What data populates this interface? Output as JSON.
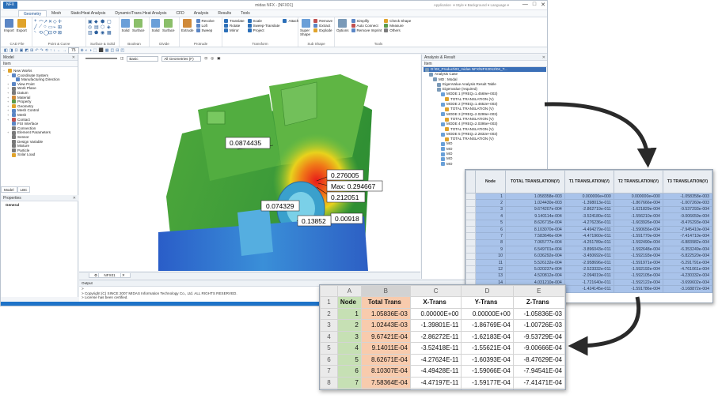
{
  "window": {
    "title": "midas NFX - [NFX01]",
    "logo": "NFX",
    "right_items": [
      "Application",
      "Style",
      "Background",
      "Language"
    ],
    "controls": [
      "—",
      "□",
      "✕"
    ]
  },
  "menu": {
    "tabs": [
      "Geometry",
      "Mesh",
      "Static/Heat Analysis",
      "Dynamic/Trans.Heat Analysis",
      "CFD",
      "Analysis",
      "Results",
      "Tools"
    ],
    "active": "Geometry"
  },
  "ribbon": {
    "cad_file": {
      "label": "CAD File",
      "buttons": [
        "Import",
        "Export"
      ]
    },
    "point_curve": {
      "label": "Point & Curve"
    },
    "surface_solid": {
      "label": "Surface & Solid"
    },
    "boolean": {
      "label": "Boolean",
      "buttons": [
        "Solid",
        "Surface"
      ]
    },
    "divide": {
      "label": "Divide",
      "buttons": [
        "Solid",
        "Surface"
      ]
    },
    "protrude": {
      "label": "Protrude",
      "buttons": [
        "Extrude",
        "Revolve",
        "Loft",
        "Sweep"
      ]
    },
    "transform": {
      "label": "Transform",
      "items": [
        "Translate",
        "Rotate",
        "Mirror",
        "Scale",
        "Sweep-Translate",
        "Project",
        "Attach"
      ]
    },
    "sub_shape": {
      "label": "Sub Shape",
      "buttons": [
        "Super Shape",
        "Remove",
        "Extract",
        "Explode"
      ]
    },
    "tools": {
      "label": "Tools",
      "buttons": [
        "Options",
        "Simplify",
        "Auto Connect",
        "Remove Imprint",
        "Check Shape",
        "Measure",
        "Others"
      ]
    }
  },
  "viewport_toolbar": {
    "style_select": "Basic",
    "filter_select": "All Geometries (F)",
    "zoom": "75"
  },
  "left_panel": {
    "title": "Model",
    "tree_header": "Item",
    "tree": [
      {
        "label": "New Works",
        "indent": 0,
        "exp": "−",
        "color": "#e0a32b"
      },
      {
        "label": "Coordinate System",
        "indent": 1,
        "exp": "−",
        "color": "#5b86c5"
      },
      {
        "label": "Manufacturing Direction",
        "indent": 2,
        "exp": "",
        "color": "#5b86c5"
      },
      {
        "label": "View Point",
        "indent": 1,
        "exp": "+",
        "color": "#5b86c5"
      },
      {
        "label": "Work Plane",
        "indent": 1,
        "exp": "+",
        "color": "#7a7a7a"
      },
      {
        "label": "Datum",
        "indent": 1,
        "exp": "+",
        "color": "#7a7a7a"
      },
      {
        "label": "Material",
        "indent": 1,
        "exp": "+",
        "color": "#d08a3a"
      },
      {
        "label": "Property",
        "indent": 1,
        "exp": "+",
        "color": "#5b9b4a"
      },
      {
        "label": "Geometry",
        "indent": 1,
        "exp": "+",
        "color": "#e0a32b"
      },
      {
        "label": "Mesh Control",
        "indent": 1,
        "exp": "+",
        "color": "#5b86c5"
      },
      {
        "label": "Mesh",
        "indent": 1,
        "exp": "+",
        "color": "#5b86c5"
      },
      {
        "label": "Contact",
        "indent": 1,
        "exp": "+",
        "color": "#c05050"
      },
      {
        "label": "FSI Interface",
        "indent": 1,
        "exp": "",
        "color": "#5b86c5"
      },
      {
        "label": "Connection",
        "indent": 1,
        "exp": "",
        "color": "#7a7a7a"
      },
      {
        "label": "Element Parameters",
        "indent": 1,
        "exp": "+",
        "color": "#7a7a7a"
      },
      {
        "label": "Sensor",
        "indent": 1,
        "exp": "",
        "color": "#7a7a7a"
      },
      {
        "label": "Design Variable",
        "indent": 1,
        "exp": "",
        "color": "#7a7a7a"
      },
      {
        "label": "Mixture",
        "indent": 1,
        "exp": "",
        "color": "#7a7a7a"
      },
      {
        "label": "Particle",
        "indent": 1,
        "exp": "",
        "color": "#7a7a7a"
      },
      {
        "label": "Solar Load",
        "indent": 1,
        "exp": "",
        "color": "#e0a32b"
      }
    ],
    "tabs": [
      "Model",
      "LBC"
    ],
    "properties_title": "Properties",
    "properties_section": "General"
  },
  "viewport": {
    "tab": "NFX01",
    "labels": [
      {
        "text": "0.0874435"
      },
      {
        "text": "0.276005"
      },
      {
        "text": "Max: 0.294667"
      },
      {
        "text": "0.212051"
      },
      {
        "text": "0.074329"
      },
      {
        "text": "0.00918"
      },
      {
        "text": "0.13852"
      }
    ]
  },
  "output": {
    "title": "Output",
    "lines": [
      ">",
      "> Copyright (C) SINCE 2007 MIDAS Information Technology Co., Ltd. ALL RIGHTS RESERVED.",
      "> License has been certified."
    ]
  },
  "right_panel": {
    "title": "Analysis & Result",
    "tree_header": "Item",
    "tree": [
      {
        "label": "D:\\03_Product\\03_midas NFX\\NFX2012\\04_T...",
        "indent": 0,
        "sel": true
      },
      {
        "label": "Analysis Case",
        "indent": 1,
        "sel": false
      },
      {
        "label": "MD : Modal",
        "indent": 2,
        "sel": false
      },
      {
        "label": "EigenValue Analysis Result Table",
        "indent": 3,
        "sel": false
      },
      {
        "label": "Eigenvalue (required)",
        "indent": 3,
        "sel": false
      },
      {
        "label": "MODE 1 (FREQ=1.4569e+003)",
        "indent": 4,
        "sel": false
      },
      {
        "label": "TOTAL TRANSLATION (V)",
        "indent": 5,
        "sel": false
      },
      {
        "label": "MODE 2 (FREQ=1.4652e+003)",
        "indent": 4,
        "sel": false
      },
      {
        "label": "TOTAL TRANSLATION (V)",
        "indent": 5,
        "sel": false
      },
      {
        "label": "MODE 3 (FREQ=2.0299e+003)",
        "indent": 4,
        "sel": false
      },
      {
        "label": "TOTAL TRANSLATION (V)",
        "indent": 5,
        "sel": false
      },
      {
        "label": "MODE 4 (FREQ=2.0395e+003)",
        "indent": 4,
        "sel": false
      },
      {
        "label": "TOTAL TRANSLATION (V)",
        "indent": 5,
        "sel": false
      },
      {
        "label": "MODE 5 (FREQ=2.2832e+003)",
        "indent": 4,
        "sel": false
      },
      {
        "label": "TOTAL TRANSLATION (V)",
        "indent": 5,
        "sel": false
      },
      {
        "label": "MO",
        "indent": 4,
        "sel": false
      },
      {
        "label": "MO",
        "indent": 4,
        "sel": false
      },
      {
        "label": "MO",
        "indent": 4,
        "sel": false
      },
      {
        "label": "MO",
        "indent": 4,
        "sel": false
      },
      {
        "label": "MO",
        "indent": 4,
        "sel": false
      }
    ]
  },
  "result_table": {
    "headers": [
      "",
      "Node",
      "TOTAL TRANSLATION(V)",
      "T1 TRANSLATION(V)",
      "T2 TRANSLATION(V)",
      "T3 TRANSLATION(V)"
    ],
    "rows": [
      [
        "",
        "1",
        "1.058358e-003",
        "0.000000e+000",
        "0.000000e+000",
        "-1.058358e-003"
      ],
      [
        "",
        "2",
        "1.024430e-003",
        "-1.398013e-011",
        "-1.867666e-004",
        "-1.007260e-003"
      ],
      [
        "",
        "3",
        "9.674207e-004",
        "-2.862719e-011",
        "-1.621829e-004",
        "-9.537293e-004"
      ],
      [
        "",
        "4",
        "9.140114e-004",
        "-3.524180e-011",
        "-1.556210e-004",
        "-9.006659e-004"
      ],
      [
        "",
        "5",
        "8.626715e-004",
        "-4.276236e-011",
        "-1.603926e-004",
        "-8.476293e-004"
      ],
      [
        "",
        "6",
        "8.103070e-004",
        "-4.494279e-011",
        "-1.590656e-004",
        "-7.945410e-004"
      ],
      [
        "",
        "7",
        "7.583646e-004",
        "-4.471960e-011",
        "-1.591770e-004",
        "-7.414710e-004"
      ],
      [
        "",
        "8",
        "7.065777e-004",
        "-4.251789e-011",
        "-1.592490e-004",
        "-6.883982e-004"
      ],
      [
        "",
        "9",
        "6.549701e-004",
        "-3.896043e-011",
        "-1.592648e-004",
        "-6.353249e-004"
      ],
      [
        "",
        "10",
        "6.036292e-004",
        "-3.450692e-011",
        "-1.592193e-004",
        "-5.822520e-004"
      ],
      [
        "",
        "11",
        "5.526132e-004",
        "-2.958696e-011",
        "-1.591971e-004",
        "-5.291791e-004"
      ],
      [
        "",
        "12",
        "5.020237e-004",
        "-2.523332e-011",
        "-1.592192e-004",
        "-4.761061e-004"
      ],
      [
        "",
        "13",
        "4.520812e-004",
        "-2.094019e-011",
        "-1.592105e-004",
        "-4.230332e-004"
      ],
      [
        "",
        "14",
        "4.031210e-004",
        "-1.721640e-011",
        "-1.592122e-004",
        "-3.699602e-004"
      ],
      [
        "",
        "15",
        "3.565212e-004",
        "-1.424145e-011",
        "-1.591786e-004",
        "-3.168872e-004"
      ]
    ]
  },
  "excel": {
    "columns": [
      "A",
      "B",
      "C",
      "D",
      "E"
    ],
    "headers": [
      "Node",
      "Total Trans",
      "X-Trans",
      "Y-Trans",
      "Z-Trans"
    ],
    "rows": [
      [
        "1",
        "1.05836E-03",
        "0.00000E+00",
        "0.00000E+00",
        "-1.05836E-03"
      ],
      [
        "2",
        "1.02443E-03",
        "-1.39801E-11",
        "-1.86769E-04",
        "-1.00726E-03"
      ],
      [
        "3",
        "9.67421E-04",
        "-2.86272E-11",
        "-1.62183E-04",
        "-9.53729E-04"
      ],
      [
        "4",
        "9.14011E-04",
        "-3.52418E-11",
        "-1.55621E-04",
        "-9.00666E-04"
      ],
      [
        "5",
        "8.62671E-04",
        "-4.27624E-11",
        "-1.60393E-04",
        "-8.47629E-04"
      ],
      [
        "6",
        "8.10307E-04",
        "-4.49428E-11",
        "-1.59066E-04",
        "-7.94541E-04"
      ],
      [
        "7",
        "7.58364E-04",
        "-4.47197E-11",
        "-1.59177E-04",
        "-7.41471E-04"
      ],
      [
        "8",
        "7.06578E-04",
        "-4.25179E-11",
        "-1.59249E-04",
        "-6.88398E-04"
      ]
    ]
  },
  "colors": {
    "accent": "#1e73c8",
    "selection": "#a9c3ea",
    "node_fill": "#c6e0b4",
    "total_fill": "#f8cbad",
    "arrow": "#2a2a2a"
  }
}
